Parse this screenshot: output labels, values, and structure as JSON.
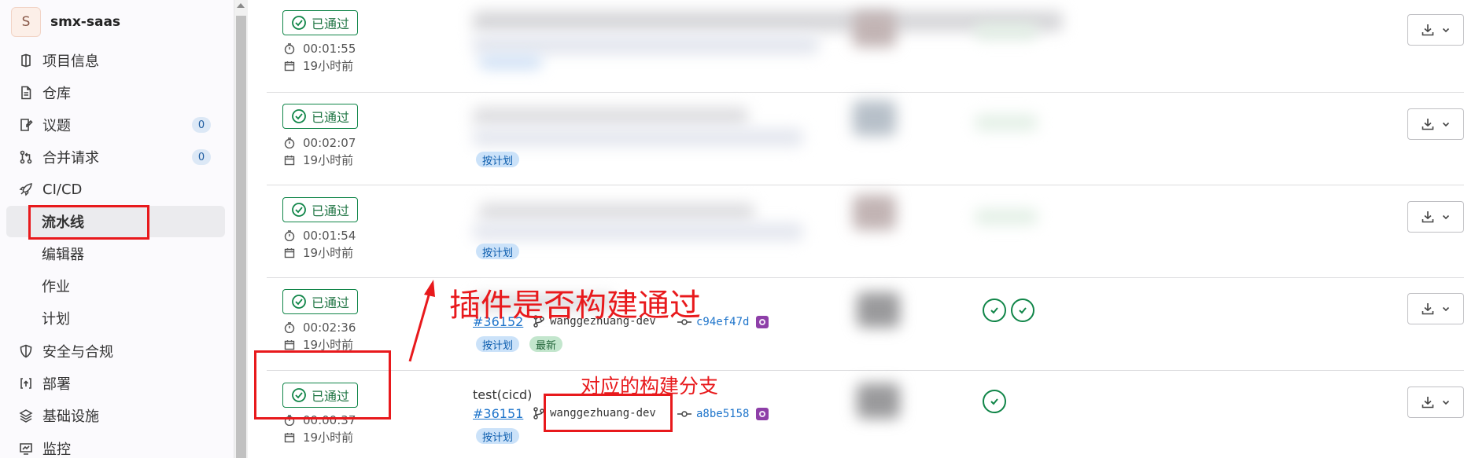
{
  "project": {
    "avatar_letter": "S",
    "name": "smx-saas"
  },
  "sidebar": {
    "items": [
      {
        "label": "项目信息",
        "icon": "project-info-icon"
      },
      {
        "label": "仓库",
        "icon": "document-icon"
      },
      {
        "label": "议题",
        "icon": "issues-icon",
        "count": "0"
      },
      {
        "label": "合并请求",
        "icon": "merge-request-icon",
        "count": "0"
      },
      {
        "label": "CI/CD",
        "icon": "rocket-icon"
      },
      {
        "label": "流水线",
        "active": true
      },
      {
        "label": "编辑器"
      },
      {
        "label": "作业"
      },
      {
        "label": "计划"
      },
      {
        "label": "安全与合规",
        "icon": "shield-icon"
      },
      {
        "label": "部署",
        "icon": "deploy-icon"
      },
      {
        "label": "基础设施",
        "icon": "infrastructure-icon"
      },
      {
        "label": "监控",
        "icon": "monitor-icon"
      }
    ]
  },
  "pipelines": [
    {
      "status": "已通过",
      "duration": "00:01:55",
      "finished": "19小时前"
    },
    {
      "status": "已通过",
      "duration": "00:02:07",
      "finished": "19小时前",
      "tags": [
        "按计划"
      ]
    },
    {
      "status": "已通过",
      "duration": "00:01:54",
      "finished": "19小时前",
      "tags": [
        "按计划"
      ]
    },
    {
      "status": "已通过",
      "duration": "00:02:36",
      "finished": "19小时前",
      "pipeline_id": "#36152",
      "branch": "wanggezhuang-dev",
      "sha": "c94ef47d",
      "tags": [
        "按计划",
        "最新"
      ]
    },
    {
      "status": "已通过",
      "duration": "00:00:37",
      "finished": "19小时前",
      "commit_title": "test(cicd)",
      "pipeline_id": "#36151",
      "branch": "wanggezhuang-dev",
      "sha": "a8be5158",
      "tags": [
        "按计划"
      ]
    }
  ],
  "annotations": {
    "main_note": "插件是否构建通过",
    "branch_note": "对应的构建分支"
  },
  "colors": {
    "success": "#108548",
    "annotation": "#e8191c",
    "link": "#1f75cb"
  }
}
